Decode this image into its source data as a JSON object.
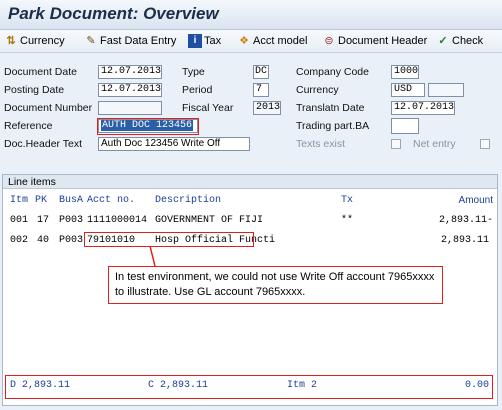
{
  "title": "Park Document: Overview",
  "toolbar": {
    "currency": "Currency",
    "fast_data_entry": "Fast Data Entry",
    "tax": "Tax",
    "acct_model": "Acct model",
    "document_header": "Document Header",
    "check": "Check"
  },
  "header": {
    "document_date_label": "Document Date",
    "document_date": "12.07.2013",
    "type_label": "Type",
    "type": "DC",
    "company_code_label": "Company Code",
    "company_code": "1000",
    "posting_date_label": "Posting Date",
    "posting_date": "12.07.2013",
    "period_label": "Period",
    "period": "7",
    "currency_label": "Currency",
    "currency": "USD",
    "document_number_label": "Document Number",
    "document_number": "",
    "fiscal_year_label": "Fiscal Year",
    "fiscal_year": "2013",
    "translatn_date_label": "Translatn Date",
    "translatn_date": "12.07.2013",
    "reference_label": "Reference",
    "reference": "AUTH DOC 123456",
    "trading_part_label": "Trading part.BA",
    "trading_part": "",
    "doc_header_text_label": "Doc.Header Text",
    "doc_header_text": "Auth Doc 123456 Write Off",
    "texts_exist_label": "Texts exist",
    "net_entry_label": "Net entry"
  },
  "line_items": {
    "title": "Line items",
    "columns": {
      "itm": "Itm",
      "pk": "PK",
      "busa": "BusA",
      "acct_no": "Acct no.",
      "description": "Description",
      "tx": "Tx",
      "amount": "Amount"
    },
    "rows": [
      {
        "itm": "001",
        "pk": "17",
        "busa": "P003",
        "acct_no": "1111000014",
        "description": "GOVERNMENT OF FIJI",
        "tx": "**",
        "amount": "2,893.11-"
      },
      {
        "itm": "002",
        "pk": "40",
        "busa": "P003",
        "acct_no": "79101010",
        "description": "Hosp Official Functi",
        "tx": "",
        "amount": "2,893.11"
      }
    ],
    "totals": {
      "debit": "D 2,893.11",
      "credit": "C 2,893.11",
      "itm": "Itm 2",
      "balance": "0.00"
    }
  },
  "annotation": "In test environment, we could not use Write Off account 7965xxxx to illustrate. Use GL account 7965xxxx.",
  "colors": {
    "highlight_red": "#e0201a",
    "selection_blue": "#2b5ea8",
    "header_text_blue": "#1a3e9a",
    "background": "#eaf0f7"
  }
}
